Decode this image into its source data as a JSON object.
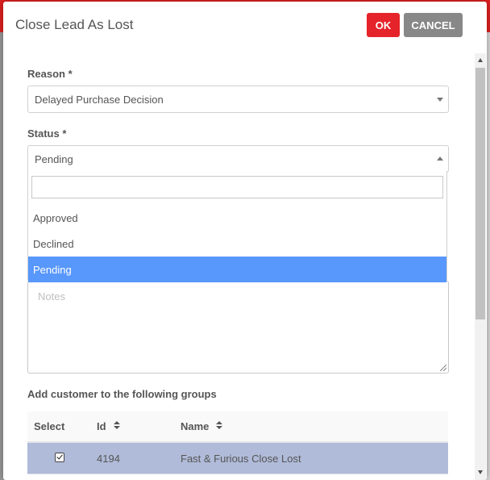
{
  "dialog": {
    "title": "Close Lead As Lost",
    "ok_label": "OK",
    "cancel_label": "CANCEL"
  },
  "form": {
    "reason": {
      "label": "Reason *",
      "value": "Delayed Purchase Decision"
    },
    "status": {
      "label": "Status *",
      "value": "Pending",
      "search_value": "",
      "options": [
        "Approved",
        "Declined",
        "Pending"
      ],
      "selected_index": 2
    },
    "notes": {
      "placeholder": "Notes",
      "value": ""
    }
  },
  "groups": {
    "heading": "Add customer to the following groups",
    "columns": [
      "Select",
      "Id",
      "Name"
    ],
    "rows": [
      {
        "selected": true,
        "id": "4194",
        "name": "Fast & Furious Close Lost"
      }
    ]
  },
  "colors": {
    "ok_button": "#e5232b",
    "cancel_button": "#888888",
    "selected_option": "#5897fb",
    "selected_row": "#b0bbd9"
  }
}
